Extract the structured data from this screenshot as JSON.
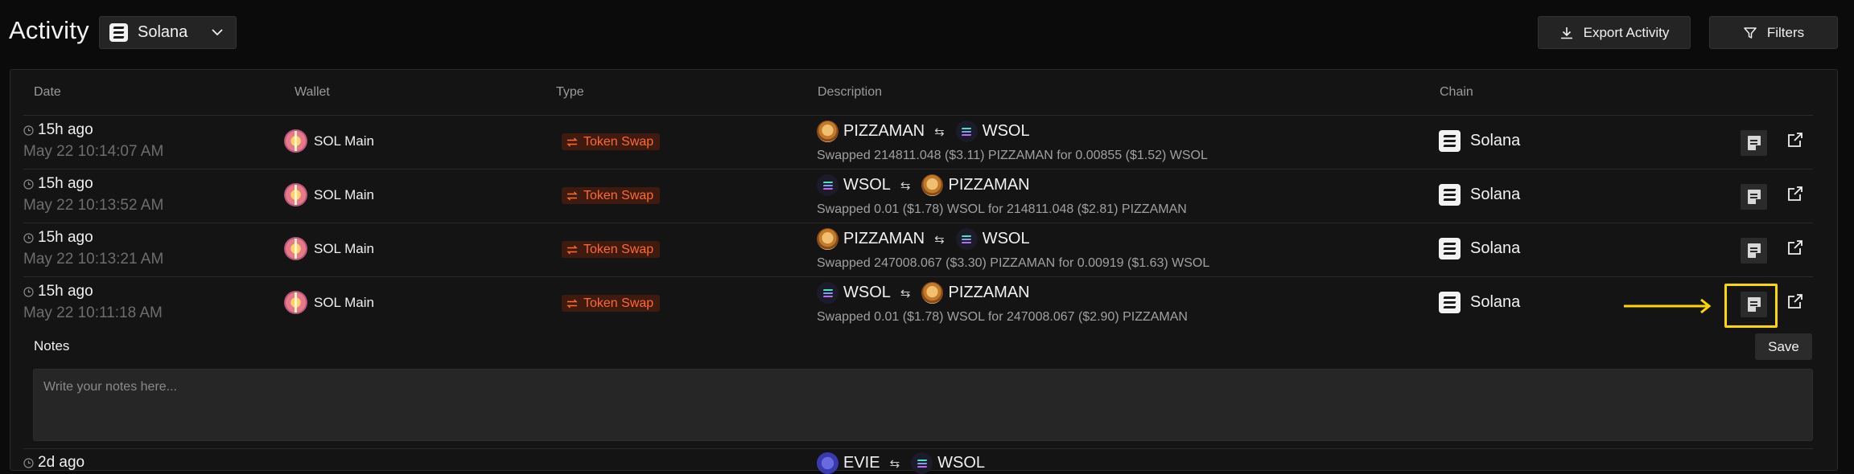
{
  "header": {
    "title": "Activity",
    "chain_select": {
      "value": "Solana",
      "icon": "solana-icon"
    },
    "export_label": "Export Activity",
    "filters_label": "Filters"
  },
  "table": {
    "columns": [
      "Date",
      "Wallet",
      "Type",
      "Description",
      "Chain"
    ],
    "rows": [
      {
        "time": "15h ago",
        "date": "May 22 10:14:07 AM",
        "wallet": "SOL Main",
        "type": "Token Swap",
        "from_token": "PIZZAMAN",
        "to_token": "WSOL",
        "summary": "Swapped 214811.048 ($3.11) PIZZAMAN for 0.00855 ($1.52) WSOL",
        "chain": "Solana"
      },
      {
        "time": "15h ago",
        "date": "May 22 10:13:52 AM",
        "wallet": "SOL Main",
        "type": "Token Swap",
        "from_token": "WSOL",
        "to_token": "PIZZAMAN",
        "summary": "Swapped 0.01 ($1.78) WSOL for 214811.048 ($2.81) PIZZAMAN",
        "chain": "Solana"
      },
      {
        "time": "15h ago",
        "date": "May 22 10:13:21 AM",
        "wallet": "SOL Main",
        "type": "Token Swap",
        "from_token": "PIZZAMAN",
        "to_token": "WSOL",
        "summary": "Swapped 247008.067 ($3.30) PIZZAMAN for 0.00919 ($1.63) WSOL",
        "chain": "Solana"
      },
      {
        "time": "15h ago",
        "date": "May 22 10:11:18 AM",
        "wallet": "SOL Main",
        "type": "Token Swap",
        "from_token": "WSOL",
        "to_token": "PIZZAMAN",
        "summary": "Swapped 0.01 ($1.78) WSOL for 247008.067 ($2.90) PIZZAMAN",
        "chain": "Solana"
      }
    ],
    "partial_row": {
      "time": "2d ago",
      "from_token": "EVIE",
      "to_token": "WSOL"
    }
  },
  "notes": {
    "label": "Notes",
    "placeholder": "Write your notes here...",
    "value": "",
    "save_label": "Save"
  },
  "colors": {
    "background": "#0b0b0b",
    "panel": "#141414",
    "badge_text": "#ff6a2e",
    "badge_bg": "#3f1a0f",
    "annotation": "#ffd600"
  }
}
